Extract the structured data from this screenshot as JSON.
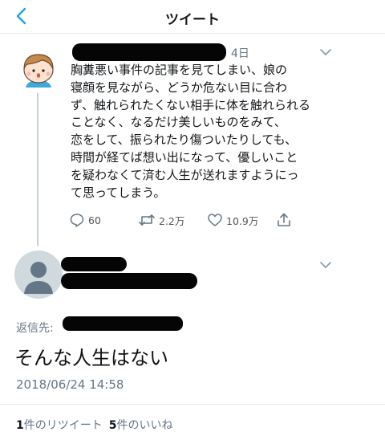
{
  "nav": {
    "title": "ツイート",
    "back_icon": "chevron-left-icon"
  },
  "colors": {
    "accent": "#1da1f2",
    "muted": "#657786",
    "redaction": "#050505"
  },
  "tweet": {
    "time_ago": "4日",
    "text": "胸糞悪い事件の記事を見てしまい、娘の\n寝顔を見ながら、どうか危ない目に合わ\nず、触れられたくない相手に体を触れられる\nことなく、なるだけ美しいものをみて、\n恋をして、振られたり傷ついたりしても、\n時間が経てば想い出になって、優しいこと\nを疑わなくて済む人生が送れますようにっ\nて思ってしまう。",
    "actions": {
      "replies": "60",
      "retweets": "2.2万",
      "likes": "10.9万"
    }
  },
  "reply": {
    "reply_to_label": "返信先:",
    "text": "そんな人生はない",
    "date": "2018/06/24 14:58"
  },
  "stats": {
    "retweet_count": "1",
    "retweet_label": "件のリツイート",
    "like_count": "5",
    "like_label": "件のいいね"
  }
}
